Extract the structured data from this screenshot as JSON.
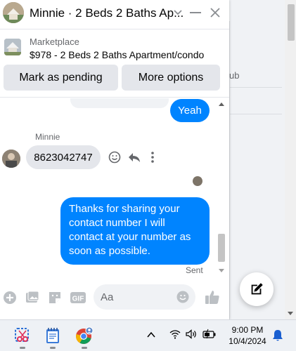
{
  "chat": {
    "title": "Minnie · 2 Beds 2 Baths Ap...",
    "listing": {
      "label": "Marketplace",
      "description": "$978 - 2 Beds 2 Baths Apartment/condo"
    },
    "actions": {
      "mark_pending": "Mark as pending",
      "more_options": "More options"
    },
    "messages": [
      {
        "direction": "outgoing",
        "text": "Yeah"
      },
      {
        "direction": "incoming",
        "sender": "Minnie",
        "text": "8623042747"
      },
      {
        "direction": "outgoing",
        "text": "Thanks for sharing your contact number I will contact at your number as soon as possible.",
        "status": "Sent"
      }
    ],
    "composer": {
      "placeholder": "Aa"
    }
  },
  "background": {
    "partial_text": "ub"
  },
  "taskbar": {
    "time": "9:00 PM",
    "date": "10/4/2024"
  },
  "colors": {
    "accent": "#0084ff",
    "incoming_bubble": "#e4e6eb",
    "icon": "#65676b"
  },
  "icons": {
    "composer": [
      "plus-circle-icon",
      "image-icon",
      "sticker-icon",
      "gif-icon",
      "emoji-icon",
      "thumbs-up-icon"
    ],
    "header": [
      "chevron-down-icon",
      "minimize-icon",
      "close-icon"
    ],
    "message_actions": [
      "react-emoji-icon",
      "reply-icon",
      "more-icon"
    ],
    "tray": [
      "chevron-up-icon",
      "wifi-icon",
      "volume-icon",
      "battery-icon",
      "notification-bell-icon"
    ]
  }
}
